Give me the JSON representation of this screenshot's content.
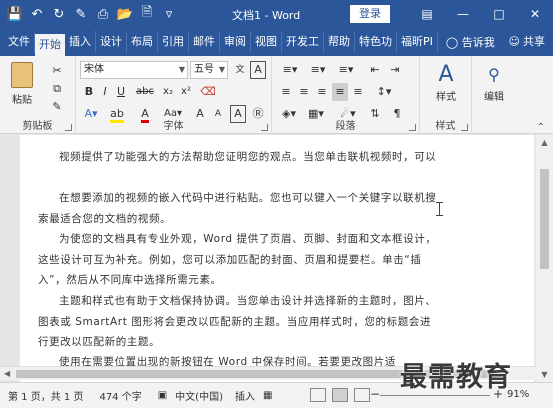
{
  "window": {
    "title": "文档1 - Word",
    "login_label": "登录",
    "controls": [
      "restore-ribbon",
      "minimize",
      "maximize",
      "close"
    ]
  },
  "quick_access": [
    "save-icon",
    "undo-icon",
    "redo-icon",
    "format-painter-icon",
    "print-preview-icon",
    "open-icon",
    "new-icon",
    "customize-icon"
  ],
  "tabs": [
    "文件",
    "开始",
    "插入",
    "设计",
    "布局",
    "引用",
    "邮件",
    "审阅",
    "视图",
    "开发工",
    "帮助",
    "特色功",
    "福昕PI"
  ],
  "active_tab": "开始",
  "tell_me": "告诉我",
  "share": "共享",
  "ribbon": {
    "clipboard": {
      "paste_label": "粘贴",
      "group_label": "剪贴板"
    },
    "font": {
      "font_name": "宋体",
      "font_size": "五号",
      "bold": "B",
      "italic": "I",
      "underline": "U",
      "strike": "abc",
      "subscript": "x₂",
      "superscript": "x²",
      "grow": "A",
      "shrink": "A",
      "group_label": "字体"
    },
    "paragraph": {
      "group_label": "段落"
    },
    "styles": {
      "label": "样式",
      "group_label": "样式"
    },
    "editing": {
      "label": "编辑"
    }
  },
  "document": {
    "paragraphs": [
      "视频提供了功能强大的方法帮助您证明您的观点。当您单击联机视频时，可以",
      "在想要添加的视频的嵌入代码中进行粘贴。您也可以键入一个关键字以联机搜索最适合您的文档的视频。",
      "为使您的文档具有专业外观，Word 提供了页眉、页脚、封面和文本框设计，这些设计可互为补充。例如，您可以添加匹配的封面、页眉和提要栏。单击“插入”，然后从不同库中选择所需元素。",
      "主题和样式也有助于文档保持协调。当您单击设计并选择新的主题时，图片、图表或 SmartArt 图形将会更改以匹配新的主题。当应用样式时，您的标题会进行更改以匹配新的主题。",
      "使用在需要位置出现的新按钮在 Word 中保存时间。若要更改图片适"
    ]
  },
  "status": {
    "page": "第 1 页，共 1 页",
    "words": "474 个字",
    "language": "中文(中国)",
    "insert_mode": "插入",
    "zoom_minus": "−",
    "zoom_plus": "+",
    "zoom": "91%"
  },
  "watermark": "最需教育"
}
